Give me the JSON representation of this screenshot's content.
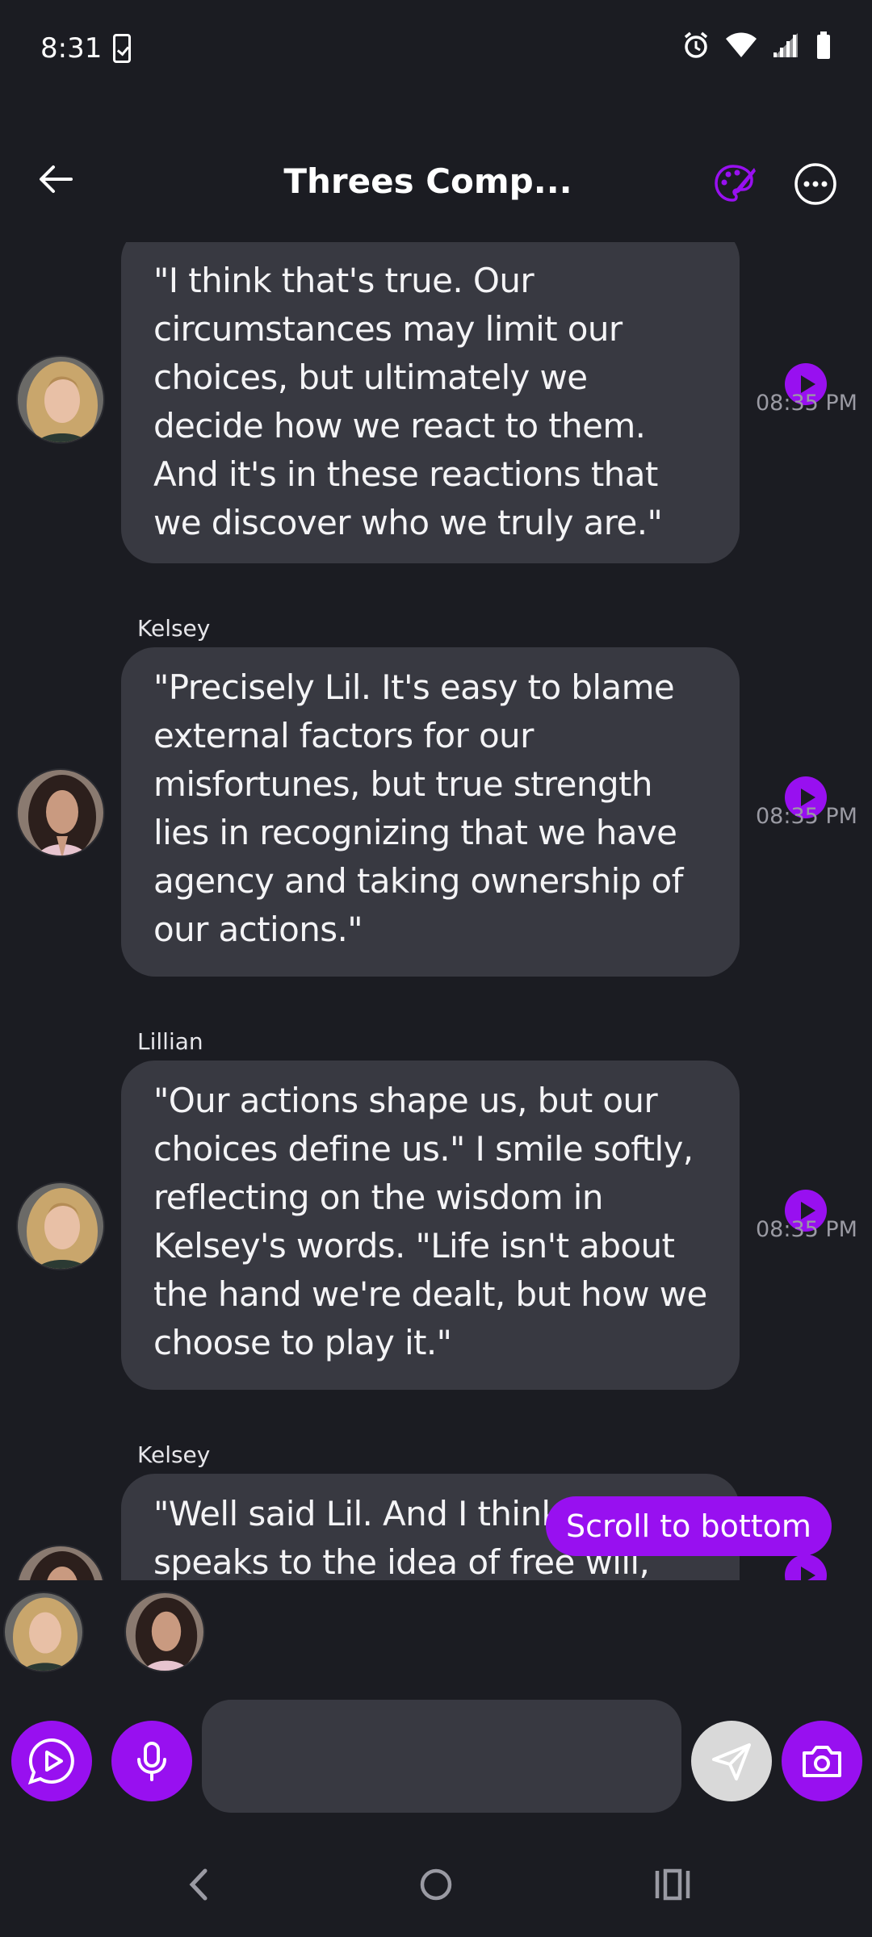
{
  "status_bar": {
    "time": "8:31"
  },
  "header": {
    "title": "Threes Comp..."
  },
  "colors": {
    "accent": "#9810f0",
    "background": "#1b1c22",
    "bubble": "#383941"
  },
  "messages": [
    {
      "sender": "",
      "text": "\"I think that's true. Our circumstances may limit our choices, but ultimately we decide how we react to them. And it's in these reactions that we discover who we truly are.\"",
      "time": "08:35 PM",
      "avatar": "lillian-avatar"
    },
    {
      "sender": "Kelsey",
      "text": "\"Precisely Lil. It's easy to blame external factors for our misfortunes, but true strength lies in recognizing that we have agency and taking ownership of our actions.\"",
      "time": "08:35 PM",
      "avatar": "kelsey-avatar"
    },
    {
      "sender": "Lillian",
      "text": "\"Our actions shape us, but our choices define us.\" I smile softly, reflecting on the wisdom in Kelsey's words. \"Life isn't about the hand we're dealt, but how we choose to play it.\"",
      "time": "08:35 PM",
      "avatar": "lillian-avatar"
    },
    {
      "sender": "Kelsey",
      "text": "\"Well said Lil. And I think it speaks to the idea of free will, where we",
      "time": "",
      "avatar": "kelsey-avatar"
    }
  ],
  "scroll_to_bottom_label": "Scroll to bottom",
  "input": {
    "placeholder": ""
  }
}
